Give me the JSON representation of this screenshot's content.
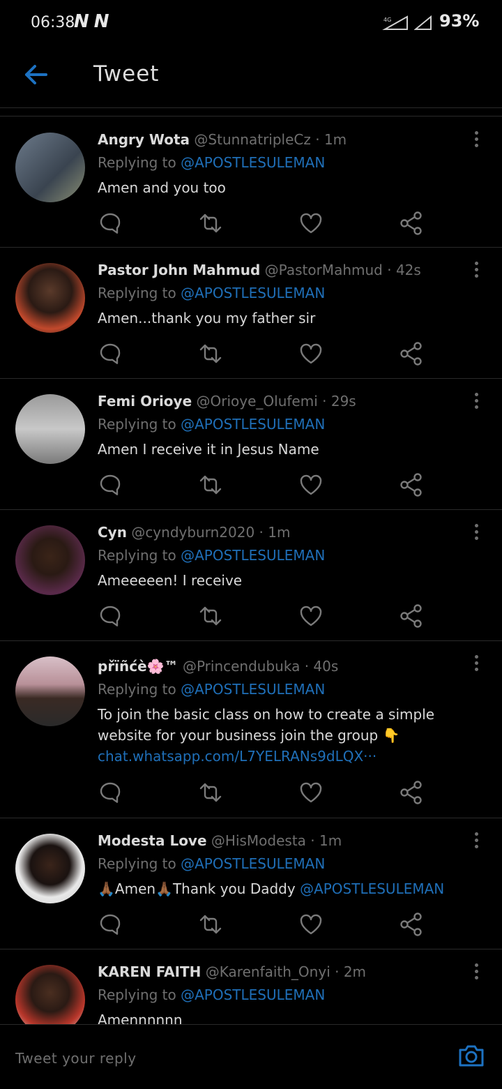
{
  "status_bar": {
    "time": "06:38",
    "network_badge": "N N",
    "battery": "93%"
  },
  "header": {
    "title": "Tweet"
  },
  "tweets": [
    {
      "name": "Angry Wota",
      "handle": "@StunnatripleCz",
      "time": "1m",
      "replying_prefix": "Replying to ",
      "replying_to": "@APOSTLESULEMAN",
      "text": "Amen and you too"
    },
    {
      "name": "Pastor John Mahmud",
      "handle": "@PastorMahmud",
      "time": "42s",
      "replying_prefix": "Replying to ",
      "replying_to": "@APOSTLESULEMAN",
      "text": "Amen...thank you my father sir"
    },
    {
      "name": "Femi Orioye",
      "handle": "@Orioye_Olufemi",
      "time": "29s",
      "replying_prefix": "Replying to ",
      "replying_to": "@APOSTLESULEMAN",
      "text": "Amen I receive it in Jesus Name"
    },
    {
      "name": "Cyn",
      "handle": "@cyndyburn2020",
      "time": "1m",
      "replying_prefix": "Replying to ",
      "replying_to": "@APOSTLESULEMAN",
      "text": "Ameeeeen! I receive"
    },
    {
      "name": "přïñćè🌸™",
      "handle": "@Princendubuka",
      "time": "40s",
      "replying_prefix": "Replying to ",
      "replying_to": "@APOSTLESULEMAN",
      "text": "To join the basic class on how to create a simple website for your business join the group 👇",
      "link": "chat.whatsapp.com/L7YELRANs9dLQX···"
    },
    {
      "name": "Modesta Love",
      "handle": "@HisModesta",
      "time": "1m",
      "replying_prefix": "Replying to ",
      "replying_to": "@APOSTLESULEMAN",
      "text": "🙏🏾Amen🙏🏾Thank you Daddy ",
      "text_mention": "@APOSTLESULEMAN"
    },
    {
      "name": "KAREN FAITH",
      "handle": "@Karenfaith_Onyi",
      "time": "2m",
      "replying_prefix": "Replying to ",
      "replying_to": "@APOSTLESULEMAN",
      "text": "Amennnnnn"
    }
  ],
  "reply_bar": {
    "placeholder": "Tweet your reply"
  },
  "icons": {
    "back": "back-arrow-icon",
    "more": "more-vertical-icon",
    "reply": "reply-icon",
    "retweet": "retweet-icon",
    "like": "heart-icon",
    "share": "share-icon",
    "camera": "camera-icon"
  },
  "colors": {
    "accent": "#1f6fb8",
    "background": "#000000",
    "muted": "#6f6f6f"
  }
}
